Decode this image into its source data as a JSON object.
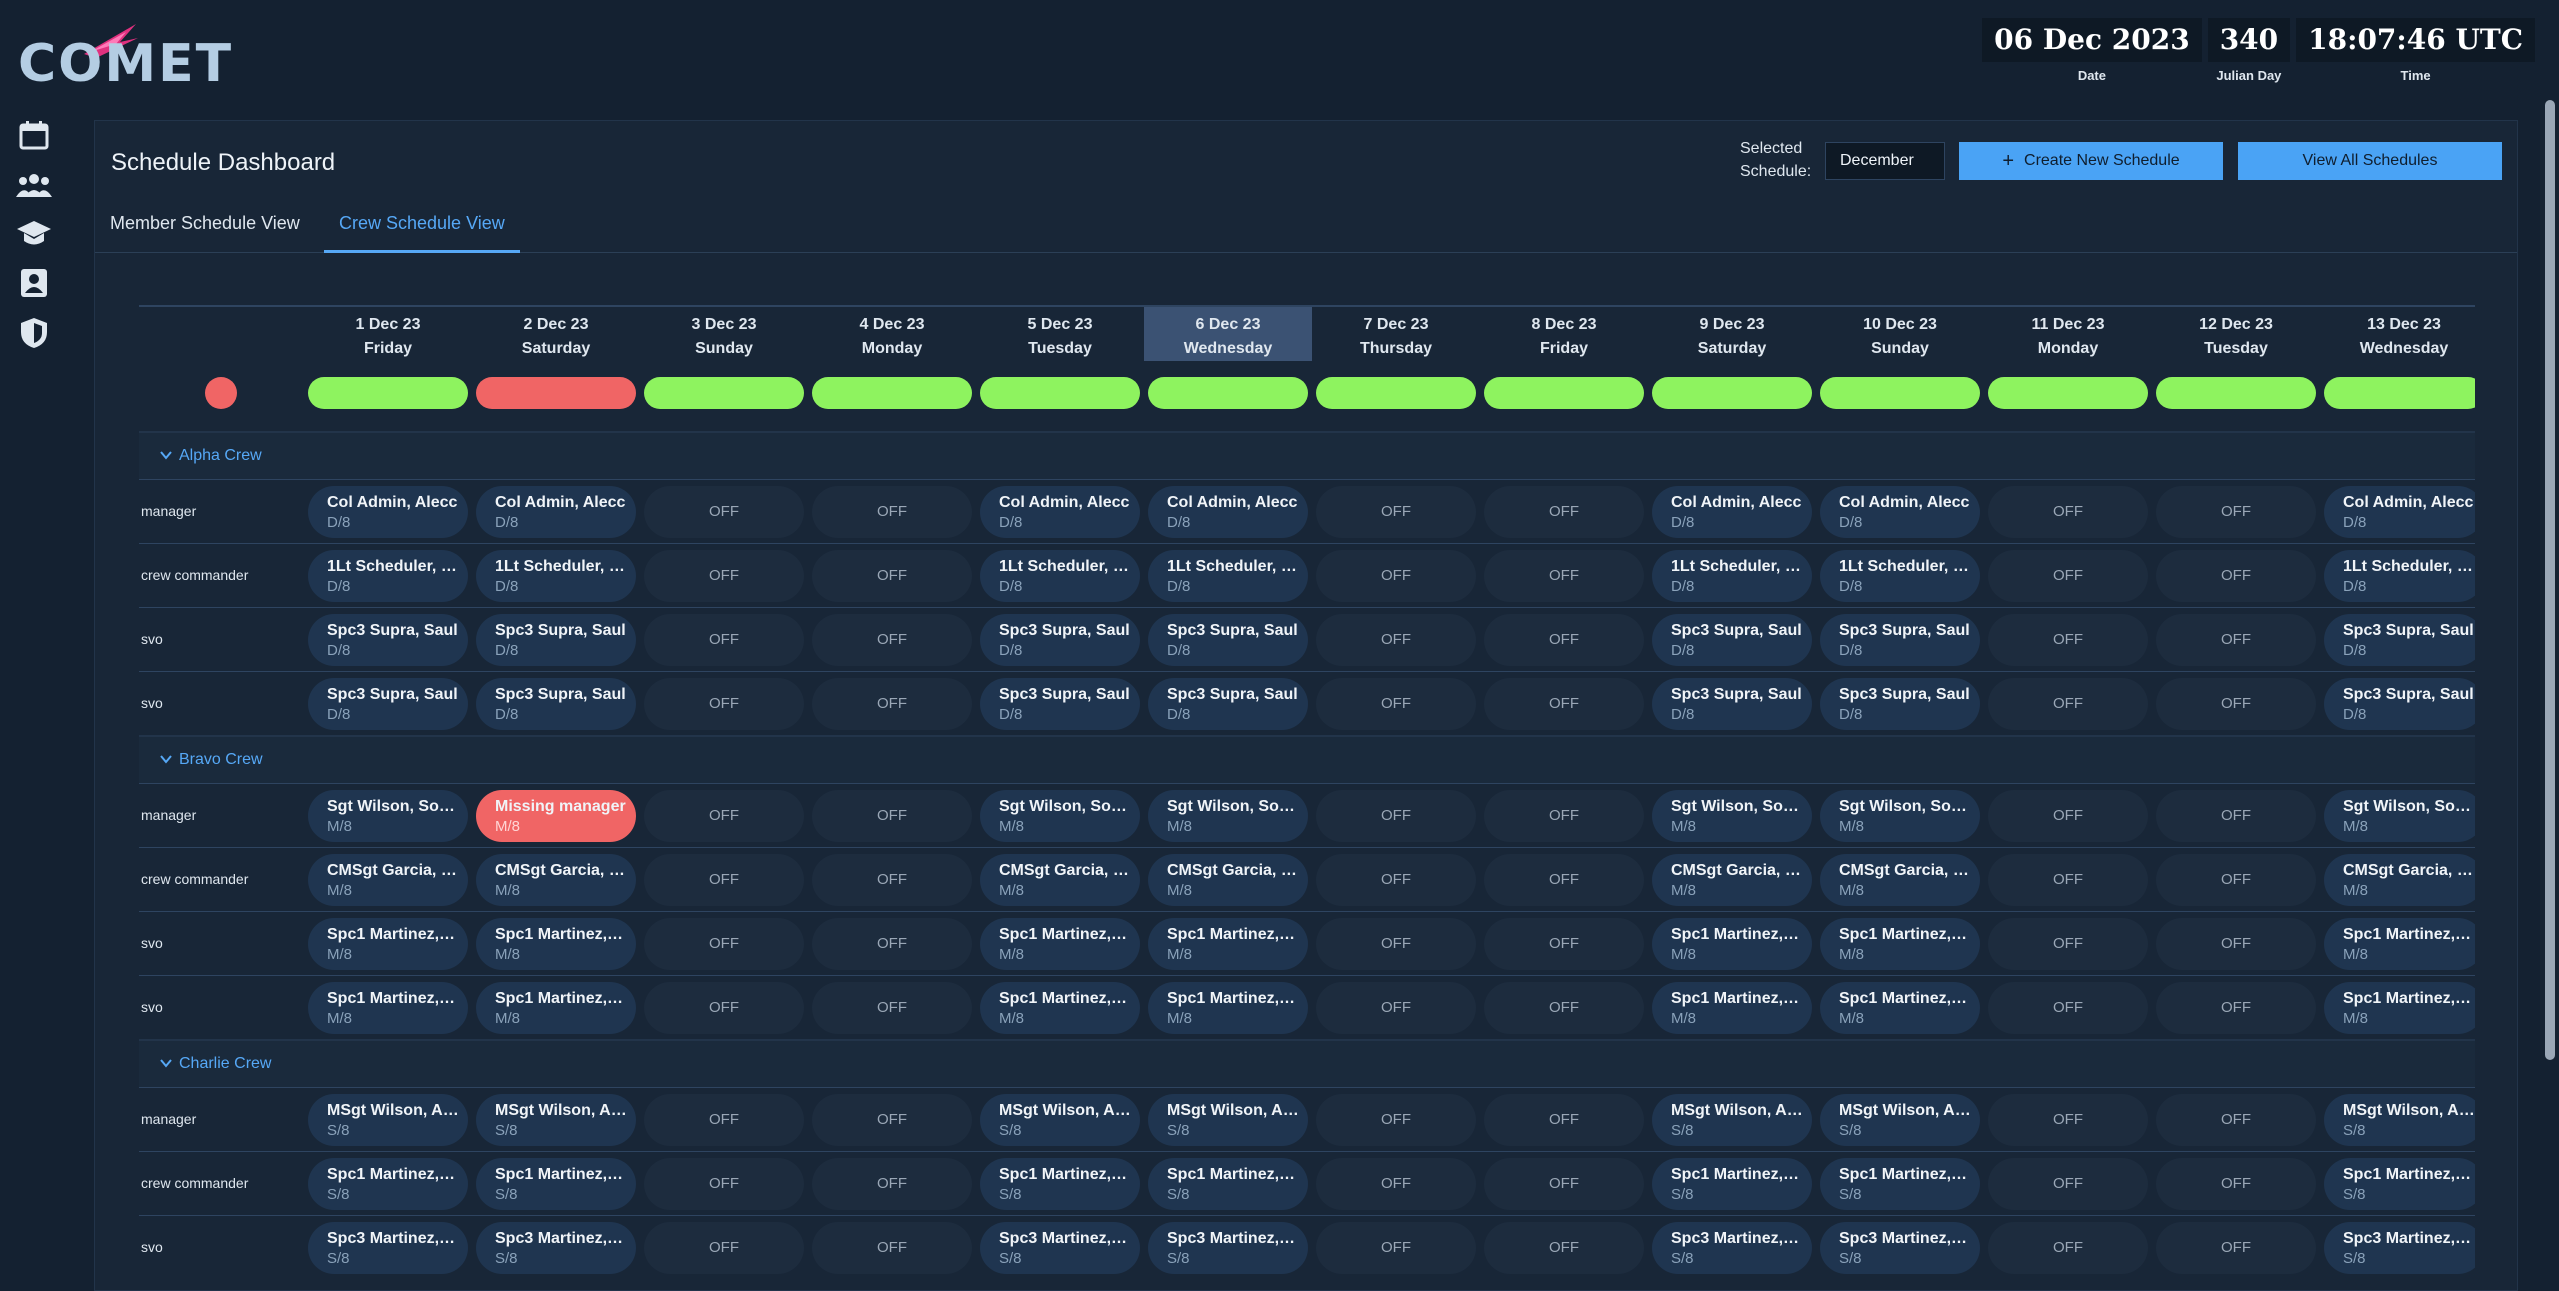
{
  "app": {
    "logo_text": "COMET"
  },
  "clock": {
    "date": "06 Dec 2023",
    "date_label": "Date",
    "julian": "340",
    "julian_label": "Julian Day",
    "time": "18:07:46 UTC",
    "time_label": "Time"
  },
  "nav": [
    "calendar-icon",
    "users-icon",
    "graduation-cap-icon",
    "contact-card-icon",
    "shield-icon"
  ],
  "page": {
    "title": "Schedule Dashboard",
    "selected_schedule_label": "Selected Schedule:",
    "selected_schedule_value": "December",
    "create_button": "Create New Schedule",
    "view_all_button": "View All Schedules",
    "tabs": [
      "Member Schedule View",
      "Crew Schedule View"
    ],
    "active_tab": 1
  },
  "colors": {
    "accent": "#56a8f6",
    "ok": "#8ef35f",
    "missing": "#f06565",
    "today": "#3b5273"
  },
  "days": [
    {
      "date": "1 Dec 23",
      "weekday": "Friday",
      "status": "ok"
    },
    {
      "date": "2 Dec 23",
      "weekday": "Saturday",
      "status": "missing"
    },
    {
      "date": "3 Dec 23",
      "weekday": "Sunday",
      "status": "ok"
    },
    {
      "date": "4 Dec 23",
      "weekday": "Monday",
      "status": "ok"
    },
    {
      "date": "5 Dec 23",
      "weekday": "Tuesday",
      "status": "ok"
    },
    {
      "date": "6 Dec 23",
      "weekday": "Wednesday",
      "status": "ok",
      "today": true
    },
    {
      "date": "7 Dec 23",
      "weekday": "Thursday",
      "status": "ok"
    },
    {
      "date": "8 Dec 23",
      "weekday": "Friday",
      "status": "ok"
    },
    {
      "date": "9 Dec 23",
      "weekday": "Saturday",
      "status": "ok"
    },
    {
      "date": "10 Dec 23",
      "weekday": "Sunday",
      "status": "ok"
    },
    {
      "date": "11 Dec 23",
      "weekday": "Monday",
      "status": "ok"
    },
    {
      "date": "12 Dec 23",
      "weekday": "Tuesday",
      "status": "ok"
    },
    {
      "date": "13 Dec 23",
      "weekday": "Wednesday",
      "status": "ok"
    }
  ],
  "off_label": "OFF",
  "on_days": [
    0,
    1,
    4,
    5,
    8,
    9,
    12
  ],
  "crews": [
    {
      "name": "Alpha Crew",
      "shift": "D/8",
      "roles": [
        {
          "role": "manager",
          "member": "Col Admin, Alecc"
        },
        {
          "role": "crew commander",
          "member": "1Lt Scheduler, S..."
        },
        {
          "role": "svo",
          "member": "Spc3 Supra, Saul"
        },
        {
          "role": "svo",
          "member": "Spc3 Supra, Saul"
        }
      ]
    },
    {
      "name": "Bravo Crew",
      "shift": "M/8",
      "roles": [
        {
          "role": "manager",
          "member": "Sgt Wilson, Sop...",
          "missing_days": [
            1
          ],
          "missing_label": "Missing manager"
        },
        {
          "role": "crew commander",
          "member": "CMSgt Garcia, J..."
        },
        {
          "role": "svo",
          "member": "Spc1 Martinez, J..."
        },
        {
          "role": "svo",
          "member": "Spc1 Martinez, J..."
        }
      ]
    },
    {
      "name": "Charlie Crew",
      "shift": "S/8",
      "roles": [
        {
          "role": "manager",
          "member": "MSgt Wilson, Al..."
        },
        {
          "role": "crew commander",
          "member": "Spc1 Martinez, J..."
        },
        {
          "role": "svo",
          "member": "Spc3 Martinez, I..."
        }
      ]
    }
  ]
}
